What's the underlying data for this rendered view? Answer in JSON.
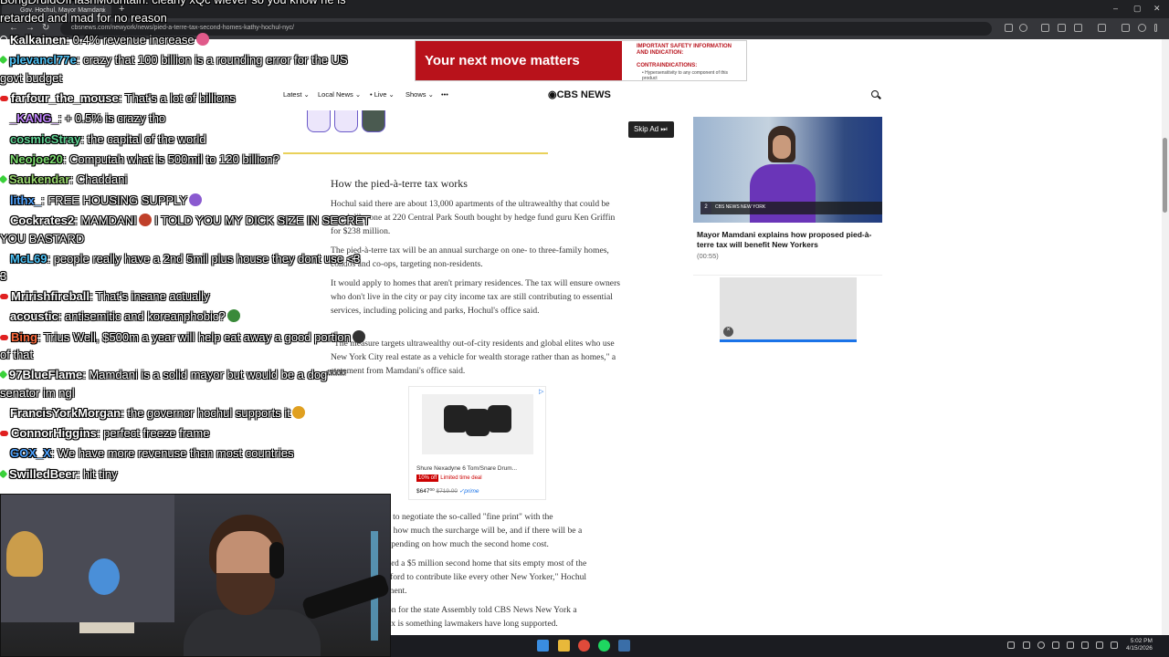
{
  "browser": {
    "tab_title": "Gov. Hochul, Mayor Mamdani",
    "url": "cbsnews.com/newyork/news/pied-a-terre-tax-second-homes-kathy-hochul-nyc/",
    "new_tab": "+",
    "tab_close": "×",
    "back": "←",
    "forward": "→",
    "reload": "↻",
    "window_min": "–",
    "window_max": "▢",
    "window_close": "✕"
  },
  "site": {
    "banner_ad": {
      "headline": "Your next move matters",
      "safety": "IMPORTANT SAFETY INFORMATION AND INDICATION:",
      "contra": "CONTRAINDICATIONS:",
      "detail": "• Hypersensitivity to any component of this product"
    },
    "nav": {
      "latest": "Latest ⌄",
      "local": "Local News ⌄",
      "live": "• Live ⌄",
      "shows": "Shows ⌄",
      "more": "•••",
      "logo": "◉CBS NEWS"
    },
    "article": {
      "heading": "How the pied-à-terre tax works",
      "p1": "Hochul said there are about 13,000 apartments of the ultrawealthy that could be taxed, like one at 220 Central Park South bought by hedge fund guru Ken Griffin for $238 million.",
      "p2": "The pied-à-terre tax will be an annual surcharge on one- to three-family homes, condos and co-ops, targeting non-residents.",
      "p3": "It would apply to homes that aren't primary residences. The tax will ensure owners who don't live in the city or pay city income tax are still contributing to essential services, including policing and parks, Hochul's office said.",
      "p4": "\"The measure targets ultrawealthy out-of-city residents and global elites who use New York City real estate as a vehicle for wealth storage rather than as homes,\" a statement from Mamdani's office said.",
      "p5a": "s to negotiate the so-called \"fine print\" with the",
      "p5b": "e how much the surcharge will be, and if there will be a",
      "p5c": "epending on how much the second home cost.",
      "p6a": "ord a $5 million second home that sits empty most of the",
      "p6b": "fford to contribute like every other New Yorker,\" Hochul",
      "p6c": "ment.",
      "p7a": "on for the state Assembly told CBS News New York a",
      "p7b": "ax is something lawmakers have long supported."
    },
    "skip_ad": "Skip Ad ⏭",
    "video": {
      "title": "Mayor Mamdani explains how proposed pied-à-terre tax will benefit New Yorkers",
      "duration": "(00:55)",
      "channel": "2",
      "lower_third": "CBS NEWS NEW YORK"
    },
    "product_ad": {
      "name": "Shure Nexadyne 6 Tom/Snare Drum...",
      "discount": "10% off",
      "deal": "Limited time deal",
      "price": "$647⁰⁰",
      "old_price": "$719.00",
      "prime": "✓prime",
      "adchoices": "▷"
    }
  },
  "chat": {
    "top_partial": "BongDruidOfHashMountain: clearly xQc wiever so you know he is",
    "top_partial2": "retarded and mad for no reason",
    "messages": [
      {
        "user": "Kalkainen",
        "text": ": 0.4% revenue increase",
        "color": "#ffffff",
        "badge": "ring"
      },
      {
        "user": "plevancl77e",
        "text": ": crazy that 100 billion is a rounding error for the US",
        "text2": "govt budget",
        "color": "#4fc3f7",
        "badge": "green"
      },
      {
        "user": "farfour_the_mouse",
        "text": ": That's a lot of billions",
        "color": "#ffffff",
        "badge": "red"
      },
      {
        "user": "_KANG_",
        "text": ": + 0.5% is crazy tho",
        "color": "#c084fc",
        "badge": "ring"
      },
      {
        "user": "cosmicStray",
        "text": ": the capital of the world",
        "color": "#60d394",
        "badge": "ring"
      },
      {
        "user": "Neojoe20",
        "text": ": Computah what is 500mil to 120 billion?",
        "color": "#7ddc6f",
        "badge": "ring"
      },
      {
        "user": "Saukendar",
        "text": ": Chaddani",
        "color": "#9ad86f",
        "badge": "green"
      },
      {
        "user": "lithx_",
        "text": ": FREE HOUSING SUPPLY",
        "color": "#4fa3ff",
        "badge": "ring"
      },
      {
        "user": "Cockrates2",
        "text": ": MAMDANI",
        "text_b": " I TOLD YOU MY DICK SIZE IN SECRET",
        "text2": "YOU BASTARD",
        "color": "#ffffff",
        "badge": "ring"
      },
      {
        "user": "McL69",
        "text": ": people really have a 2nd 5mil plus house they dont use <3",
        "text2": "3",
        "color": "#4fc3f7",
        "badge": "ring"
      },
      {
        "user": "Mririshfireball",
        "text": ": That's insane actually",
        "color": "#ffffff",
        "badge": "red"
      },
      {
        "user": "acoustic",
        "text": ": antisemitic and koreanphobic?",
        "color": "#ffffff",
        "badge": "ring"
      },
      {
        "user": "Bing",
        "text": ": Trius Well, $500m a year will help eat away a good portion",
        "text2": "of that",
        "color": "#ff6b3d",
        "badge": "red"
      },
      {
        "user": "97BlueFlame",
        "text": ": Mamdani is a solid mayor but would be a dog****",
        "text2": "senator im ngl",
        "color": "#ffffff",
        "badge": "green"
      },
      {
        "user": "FrancisYorkMorgan",
        "text": ": the governor hochul supports it",
        "color": "#ffffff",
        "badge": "ring"
      },
      {
        "user": "ConnorHiggins",
        "text": ": perfect freeze frame",
        "color": "#ffffff",
        "badge": "red"
      },
      {
        "user": "GOX_X",
        "text": ": We have more revenuse than most countries",
        "color": "#4fa3ff",
        "badge": "ring"
      },
      {
        "user": "SwilledBeer",
        "text": ": hit tiny",
        "color": "#ffffff",
        "badge": "green"
      }
    ]
  },
  "taskbar": {
    "time": "5:02 PM",
    "date": "4/15/2026"
  }
}
